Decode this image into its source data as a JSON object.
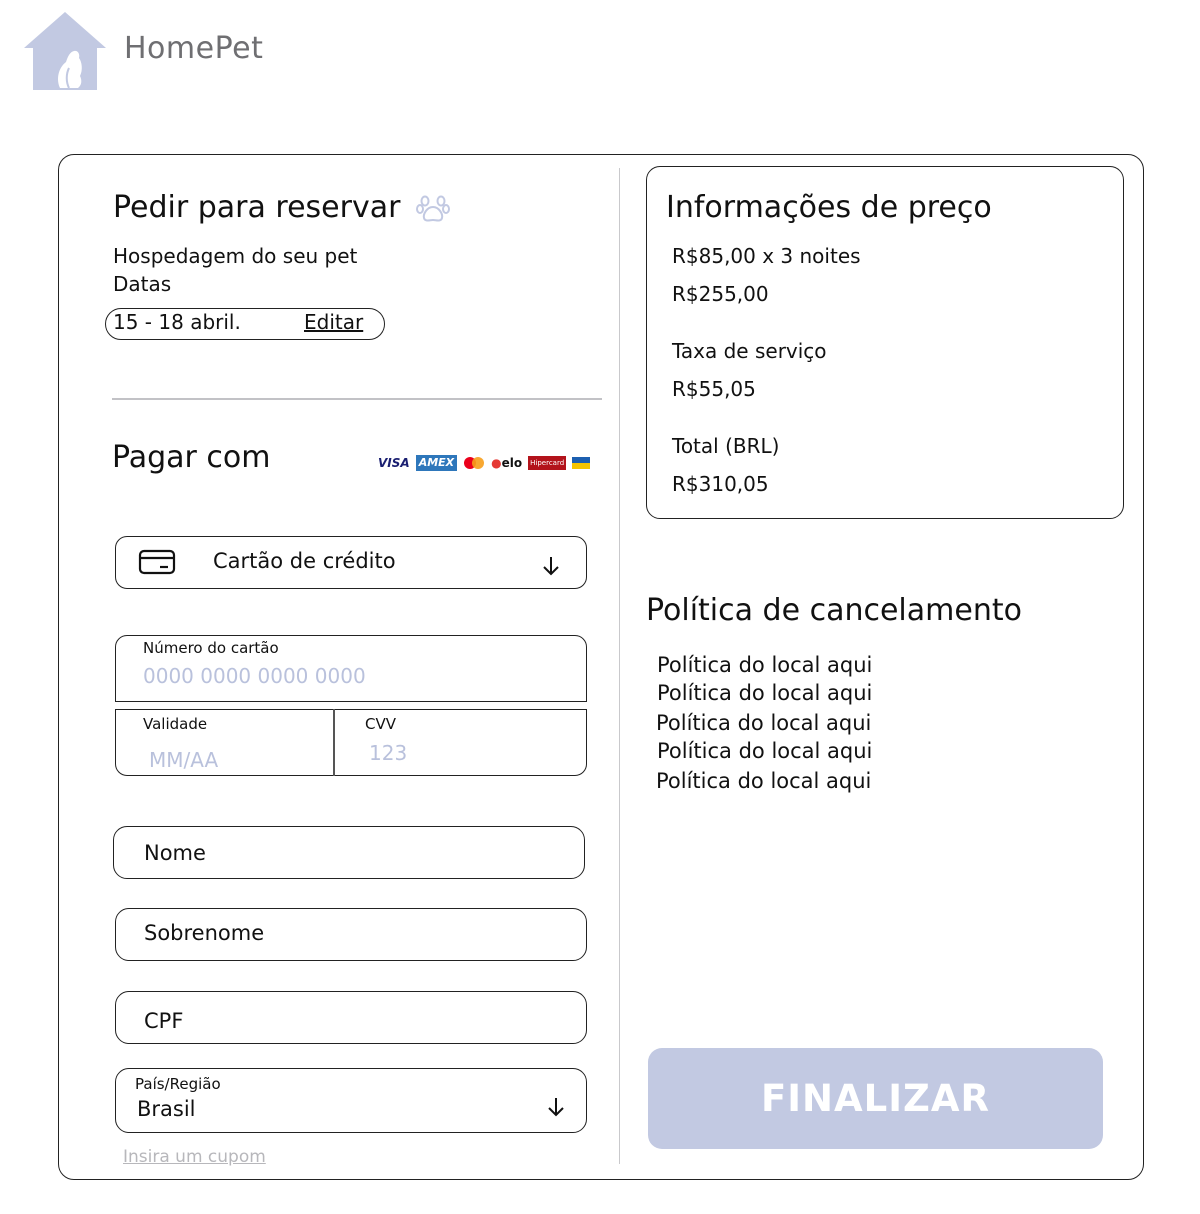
{
  "brand": {
    "name": "HomePet",
    "logo_icon": "house-dog-icon",
    "logo_color": "#c2c9e2"
  },
  "reservation": {
    "title": "Pedir para reservar",
    "title_icon": "paw-icon",
    "subtitle": "Hospedagem do seu pet",
    "dates_label": "Datas",
    "dates_value": "15 - 18 abril.",
    "edit_label": "Editar"
  },
  "payment": {
    "title": "Pagar com",
    "card_brands": [
      "VISA",
      "AMEX",
      "Mastercard",
      "elo",
      "Hipercard",
      "Banricompras"
    ],
    "method": {
      "icon": "credit-card-icon",
      "value": "Cartão de crédito"
    },
    "card_number": {
      "label": "Número do cartão",
      "placeholder": "0000 0000 0000 0000"
    },
    "expiry": {
      "label": "Validade",
      "placeholder": "MM/AA"
    },
    "cvv": {
      "label": "CVV",
      "placeholder": "123"
    },
    "name_label": "Nome",
    "surname_label": "Sobrenome",
    "cpf_label": "CPF",
    "country": {
      "label": "País/Região",
      "value": "Brasil"
    },
    "coupon_link": "Insira um cupom"
  },
  "price": {
    "title": "Informações de preço",
    "nightly": "R$85,00 x 3  noites",
    "subtotal": "R$255,00",
    "service_fee_label": "Taxa de serviço",
    "service_fee": "R$55,05",
    "total_label": "Total (BRL)",
    "total": "R$310,05"
  },
  "policy": {
    "title": "Política de cancelamento",
    "lines": [
      "Política do local aqui",
      "Política do local aqui",
      "Política do local aqui",
      "Política do local aqui",
      "Política do local aqui"
    ]
  },
  "actions": {
    "finalize_label": "FINALIZAR",
    "finalize_color": "#c2c9e2"
  }
}
